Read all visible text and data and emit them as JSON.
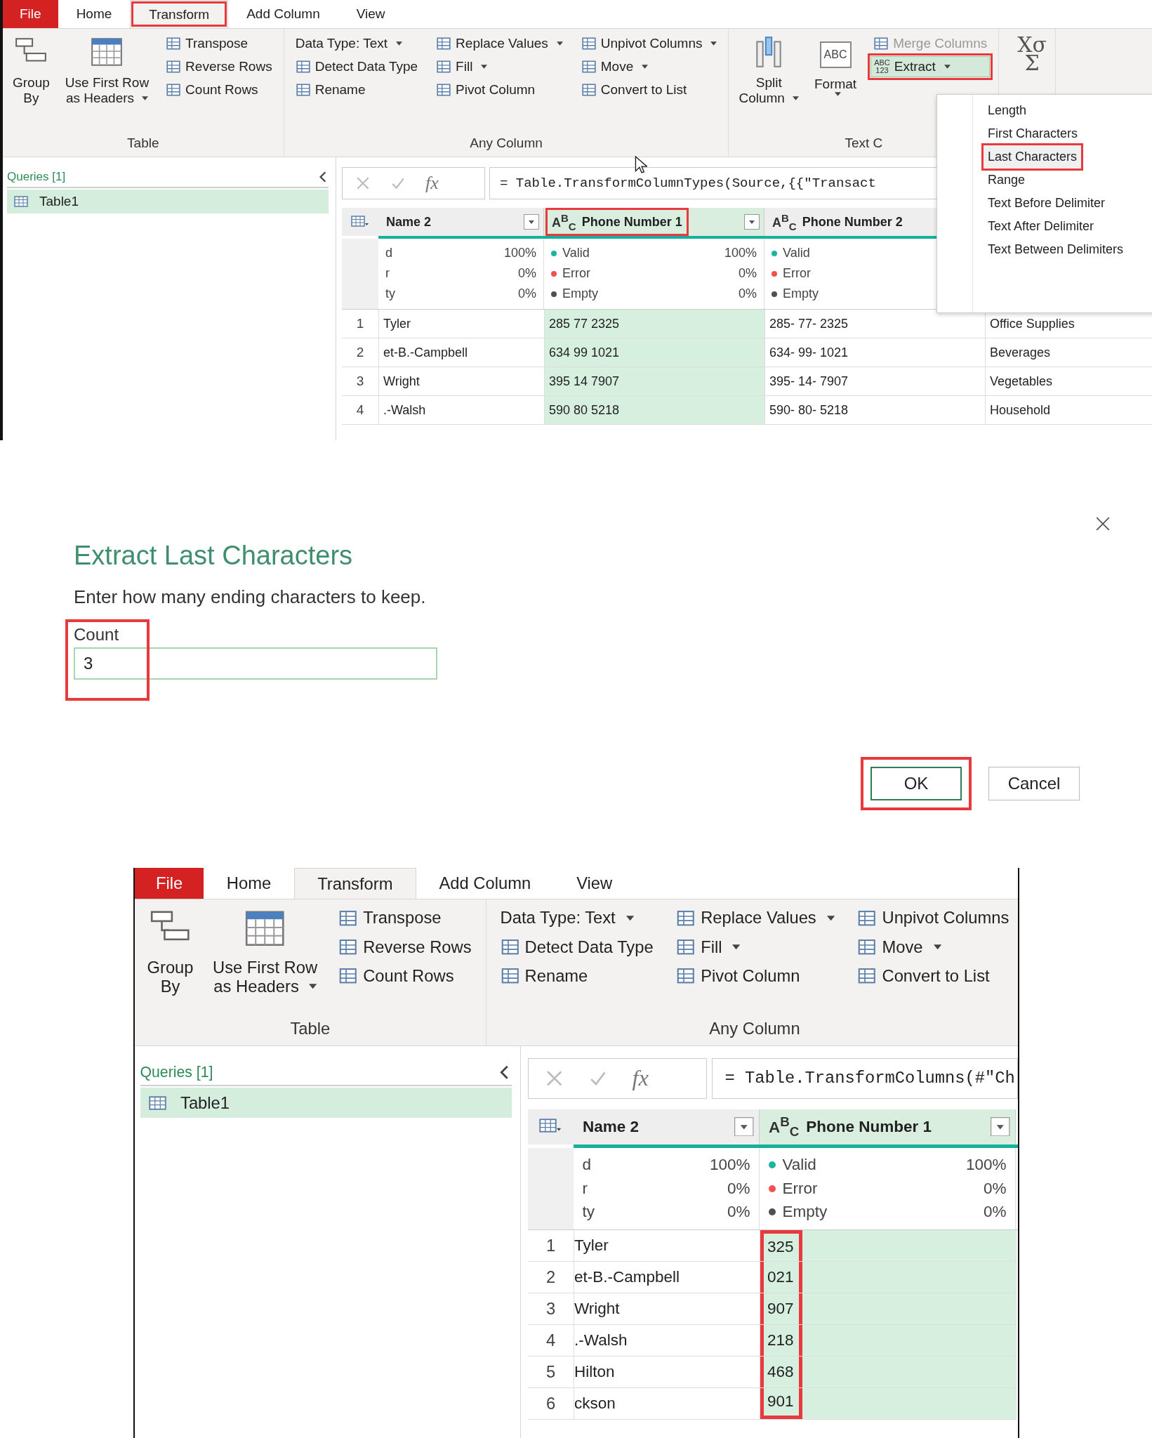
{
  "panels": [
    {
      "kind": "screen",
      "tabs": [
        {
          "label": "File",
          "kind": "file",
          "selected": false,
          "highlighted": false
        },
        {
          "label": "Home",
          "kind": "tab",
          "selected": false,
          "highlighted": false
        },
        {
          "label": "Transform",
          "kind": "tab",
          "selected": true,
          "highlighted": true
        },
        {
          "label": "Add Column",
          "kind": "tab",
          "selected": false,
          "highlighted": false
        },
        {
          "label": "View",
          "kind": "tab",
          "selected": false,
          "highlighted": false
        }
      ],
      "ribbon_groups": [
        {
          "label": "Table",
          "columns": [
            {
              "kind": "large",
              "lines": [
                "Group",
                "By"
              ],
              "dropdown": false
            },
            {
              "kind": "large",
              "lines": [
                "Use First Row",
                "as Headers"
              ],
              "dropdown": true
            },
            {
              "kind": "stack",
              "buttons": [
                {
                  "label": "Transpose",
                  "has_icon": true,
                  "dropdown": false,
                  "disabled": false,
                  "expanded": false,
                  "highlighted": false
                },
                {
                  "label": "Reverse Rows",
                  "has_icon": true,
                  "dropdown": false,
                  "disabled": false,
                  "expanded": false,
                  "highlighted": false
                },
                {
                  "label": "Count Rows",
                  "has_icon": true,
                  "dropdown": false,
                  "disabled": false,
                  "expanded": false,
                  "highlighted": false
                }
              ]
            }
          ]
        },
        {
          "label": "Any Column",
          "columns": [
            {
              "kind": "stack",
              "buttons": [
                {
                  "label": "Data Type: Text",
                  "has_icon": false,
                  "dropdown": true,
                  "disabled": false,
                  "expanded": false,
                  "highlighted": false
                },
                {
                  "label": "Detect Data Type",
                  "has_icon": true,
                  "dropdown": false,
                  "disabled": false,
                  "expanded": false,
                  "highlighted": false
                },
                {
                  "label": "Rename",
                  "has_icon": true,
                  "dropdown": false,
                  "disabled": false,
                  "expanded": false,
                  "highlighted": false
                }
              ]
            },
            {
              "kind": "stack",
              "buttons": [
                {
                  "label": "Replace Values",
                  "has_icon": true,
                  "dropdown": true,
                  "disabled": false,
                  "expanded": false,
                  "highlighted": false
                },
                {
                  "label": "Fill",
                  "has_icon": true,
                  "dropdown": true,
                  "disabled": false,
                  "expanded": false,
                  "highlighted": false
                },
                {
                  "label": "Pivot Column",
                  "has_icon": true,
                  "dropdown": false,
                  "disabled": false,
                  "expanded": false,
                  "highlighted": false
                }
              ]
            },
            {
              "kind": "stack",
              "buttons": [
                {
                  "label": "Unpivot Columns",
                  "has_icon": true,
                  "dropdown": true,
                  "disabled": false,
                  "expanded": false,
                  "highlighted": false
                },
                {
                  "label": "Move",
                  "has_icon": true,
                  "dropdown": true,
                  "disabled": false,
                  "expanded": false,
                  "highlighted": false
                },
                {
                  "label": "Convert to List",
                  "has_icon": true,
                  "dropdown": false,
                  "disabled": false,
                  "expanded": false,
                  "highlighted": false
                }
              ]
            }
          ]
        },
        {
          "label": "Text C",
          "columns": [
            {
              "kind": "large",
              "lines": [
                "Split",
                "Column"
              ],
              "dropdown": true
            },
            {
              "kind": "large",
              "lines": [
                "Format"
              ],
              "dropdown": true,
              "icon_text": "ABC"
            },
            {
              "kind": "stack",
              "buttons": [
                {
                  "label": "Merge Columns",
                  "has_icon": true,
                  "dropdown": false,
                  "disabled": true,
                  "expanded": false,
                  "highlighted": false
                },
                {
                  "label": "Extract",
                  "has_icon": true,
                  "icon_text": [
                    "ABC",
                    "123"
                  ],
                  "dropdown": true,
                  "disabled": false,
                  "expanded": true,
                  "highlighted": true
                }
              ]
            }
          ]
        },
        {
          "columns": [
            {
              "kind": "icon",
              "icon_text": [
                "Xσ",
                "Σ"
              ]
            }
          ]
        }
      ],
      "menu": {
        "items": [
          {
            "label": "Length",
            "highlighted": false
          },
          {
            "label": "First Characters",
            "highlighted": false
          },
          {
            "label": "Last Characters",
            "highlighted": true
          },
          {
            "label": "Range",
            "highlighted": false
          },
          {
            "label": "Text Before Delimiter",
            "highlighted": false
          },
          {
            "label": "Text After Delimiter",
            "highlighted": false
          },
          {
            "label": "Text Between Delimiters",
            "highlighted": false
          }
        ]
      },
      "queries": {
        "heading": "Queries [1]",
        "items": [
          {
            "label": "Table1",
            "selected": true
          }
        ]
      },
      "formula": {
        "fx": "fx",
        "text": "= Table.TransformColumnTypes(Source,{{\"Transact"
      },
      "table": {
        "columns": [
          {
            "name": "Name 2",
            "filter_button": true,
            "selected": false,
            "highlighted": false,
            "values_highlighted": false,
            "stats": [
              {
                "label": "d",
                "value": "100%"
              },
              {
                "label": "r",
                "value": "0%"
              },
              {
                "label": "ty",
                "value": "0%"
              }
            ]
          },
          {
            "name": "Phone Number 1",
            "type_label": "A$^{B}$$_{C}$",
            "filter_button": true,
            "selected": true,
            "highlighted": true,
            "values_highlighted": false,
            "stats": [
              {
                "label": "Valid",
                "value": "100%",
                "color": "#1fb39f"
              },
              {
                "label": "Error",
                "value": "0%",
                "color": "#f0514f"
              },
              {
                "label": "Empty",
                "value": "0%",
                "color": "#505050"
              }
            ]
          },
          {
            "name": "Phone Number 2",
            "type_label": "A$^{B}$$_{C}$",
            "filter_button": false,
            "selected": false,
            "highlighted": false,
            "values_highlighted": false,
            "stats": [
              {
                "label": "Valid",
                "color": "#1fb39f"
              },
              {
                "label": "Error",
                "color": "#f0514f"
              },
              {
                "label": "Empty",
                "color": "#505050"
              }
            ]
          },
          {
            "selected": false,
            "values_highlighted": false
          }
        ],
        "rows": [
          {
            "number": "1",
            "cells": [
              "Tyler",
              "285 77 2325",
              "285- 77- 2325",
              "Office Supplies"
            ]
          },
          {
            "number": "2",
            "cells": [
              "et-B.-Campbell",
              "634 99 1021",
              "634- 99- 1021",
              "Beverages"
            ]
          },
          {
            "number": "3",
            "cells": [
              "Wright",
              "395 14 7907",
              "395- 14- 7907",
              "Vegetables"
            ]
          },
          {
            "number": "4",
            "cells": [
              ".-Walsh",
              "590 80 5218",
              "590- 80- 5218",
              "Household"
            ]
          }
        ]
      }
    },
    {
      "kind": "dialog",
      "title": "Extract Last Characters",
      "instruction": "Enter how many ending characters to keep.",
      "field": {
        "label": "Count",
        "value": "3",
        "highlighted": true
      },
      "buttons": [
        {
          "label": "OK",
          "kind": "primary",
          "highlighted": true
        },
        {
          "label": "Cancel",
          "kind": "secondary",
          "highlighted": false
        }
      ]
    },
    {
      "kind": "screen",
      "tabs": [
        {
          "label": "File",
          "kind": "file",
          "selected": false,
          "highlighted": false
        },
        {
          "label": "Home",
          "kind": "tab",
          "selected": false,
          "highlighted": false
        },
        {
          "label": "Transform",
          "kind": "tab",
          "selected": true,
          "highlighted": false
        },
        {
          "label": "Add Column",
          "kind": "tab",
          "selected": false,
          "highlighted": false
        },
        {
          "label": "View",
          "kind": "tab",
          "selected": false,
          "highlighted": false
        }
      ],
      "ribbon_groups": [
        {
          "label": "Table",
          "columns": [
            {
              "kind": "large",
              "lines": [
                "Group",
                "By"
              ],
              "dropdown": false
            },
            {
              "kind": "large",
              "lines": [
                "Use First Row",
                "as Headers"
              ],
              "dropdown": true
            },
            {
              "kind": "stack",
              "buttons": [
                {
                  "label": "Transpose",
                  "has_icon": true,
                  "dropdown": false,
                  "disabled": false,
                  "expanded": false,
                  "highlighted": false
                },
                {
                  "label": "Reverse Rows",
                  "has_icon": true,
                  "dropdown": false,
                  "disabled": false,
                  "expanded": false,
                  "highlighted": false
                },
                {
                  "label": "Count Rows",
                  "has_icon": true,
                  "dropdown": false,
                  "disabled": false,
                  "expanded": false,
                  "highlighted": false
                }
              ]
            }
          ]
        },
        {
          "label": "Any Column",
          "columns": [
            {
              "kind": "stack",
              "buttons": [
                {
                  "label": "Data Type: Text",
                  "has_icon": false,
                  "dropdown": true,
                  "disabled": false,
                  "expanded": false,
                  "highlighted": false
                },
                {
                  "label": "Detect Data Type",
                  "has_icon": true,
                  "dropdown": false,
                  "disabled": false,
                  "expanded": false,
                  "highlighted": false
                },
                {
                  "label": "Rename",
                  "has_icon": true,
                  "dropdown": false,
                  "disabled": false,
                  "expanded": false,
                  "highlighted": false
                }
              ]
            },
            {
              "kind": "stack",
              "buttons": [
                {
                  "label": "Replace Values",
                  "has_icon": true,
                  "dropdown": true,
                  "disabled": false,
                  "expanded": false,
                  "highlighted": false
                },
                {
                  "label": "Fill",
                  "has_icon": true,
                  "dropdown": true,
                  "disabled": false,
                  "expanded": false,
                  "highlighted": false
                },
                {
                  "label": "Pivot Column",
                  "has_icon": true,
                  "dropdown": false,
                  "disabled": false,
                  "expanded": false,
                  "highlighted": false
                }
              ]
            },
            {
              "kind": "stack",
              "buttons": [
                {
                  "label": "Unpivot Columns",
                  "has_icon": true,
                  "dropdown": false,
                  "disabled": false,
                  "expanded": false,
                  "highlighted": false
                },
                {
                  "label": "Move",
                  "has_icon": true,
                  "dropdown": true,
                  "disabled": false,
                  "expanded": false,
                  "highlighted": false
                },
                {
                  "label": "Convert to List",
                  "has_icon": true,
                  "dropdown": false,
                  "disabled": false,
                  "expanded": false,
                  "highlighted": false
                }
              ]
            }
          ]
        }
      ],
      "queries": {
        "heading": "Queries [1]",
        "items": [
          {
            "label": "Table1",
            "selected": true
          }
        ]
      },
      "formula": {
        "fx": "fx",
        "text": "= Table.TransformColumns(#\"Ch"
      },
      "table": {
        "columns": [
          {
            "name": "Name 2",
            "filter_button": true,
            "selected": false,
            "highlighted": false,
            "values_highlighted": false,
            "stats": [
              {
                "label": "d",
                "value": "100%"
              },
              {
                "label": "r",
                "value": "0%"
              },
              {
                "label": "ty",
                "value": "0%"
              }
            ]
          },
          {
            "name": "Phone Number 1",
            "type_label": "A$^{B}$$_{C}$",
            "filter_button": true,
            "selected": true,
            "highlighted": false,
            "values_highlighted": true,
            "stats": [
              {
                "label": "Valid",
                "value": "100%",
                "color": "#1fb39f"
              },
              {
                "label": "Error",
                "value": "0%",
                "color": "#f0514f"
              },
              {
                "label": "Empty",
                "value": "0%",
                "color": "#505050"
              }
            ]
          }
        ],
        "rows": [
          {
            "number": "1",
            "cells": [
              "Tyler",
              "325"
            ]
          },
          {
            "number": "2",
            "cells": [
              "et-B.-Campbell",
              "021"
            ]
          },
          {
            "number": "3",
            "cells": [
              "Wright",
              "907"
            ]
          },
          {
            "number": "4",
            "cells": [
              ".-Walsh",
              "218"
            ]
          },
          {
            "number": "5",
            "cells": [
              "Hilton",
              "468"
            ]
          },
          {
            "number": "6",
            "cells": [
              "ckson",
              "901"
            ]
          }
        ]
      }
    }
  ]
}
